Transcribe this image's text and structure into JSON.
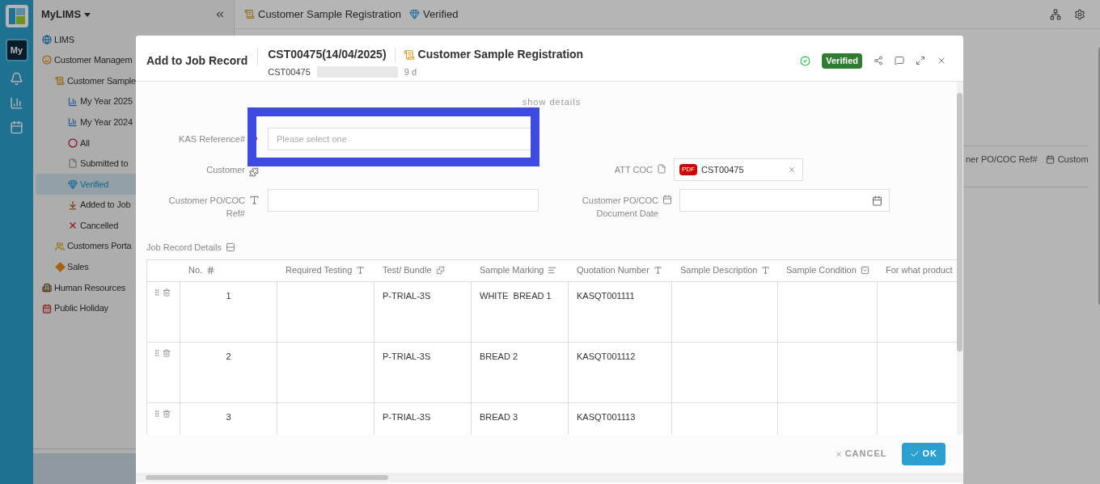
{
  "rail": {
    "badge": "My"
  },
  "sidebar": {
    "title": "MyLIMS",
    "items": [
      {
        "label": "LIMS",
        "selected": false
      },
      {
        "label": "Customer Managem",
        "selected": false,
        "children": [
          {
            "label": "Customer Sample",
            "selected": false,
            "children": [
              {
                "label": "My Year 2025",
                "selected": false
              },
              {
                "label": "My Year 2024",
                "selected": false
              },
              {
                "label": "All",
                "selected": false
              },
              {
                "label": "Submitted to",
                "selected": false
              },
              {
                "label": "Verified",
                "selected": true
              },
              {
                "label": "Added to Job",
                "selected": false
              },
              {
                "label": "Cancelled",
                "selected": false
              }
            ]
          },
          {
            "label": "Customers Porta",
            "selected": false
          },
          {
            "label": "Sales",
            "selected": false
          }
        ]
      },
      {
        "label": "Human Resources",
        "selected": false
      },
      {
        "label": "Public Holiday",
        "selected": false
      }
    ]
  },
  "top_bar": {
    "breadcrumbs": [
      "Customer Sample Registration",
      "Verified"
    ]
  },
  "background_table": {
    "columns": [
      "ner PO/COC Ref#",
      "Custom"
    ]
  },
  "dialog": {
    "title": "Add to Job Record",
    "record_title": "CST00475(14/04/2025)",
    "module": "Customer Sample Registration",
    "record_code": "CST00475",
    "age": "9 d",
    "status": "Verified",
    "show_details": "show details",
    "form_rows": [
      {
        "left": {
          "label": "KAS Reference#",
          "kind": "select",
          "placeholder": "Please select one",
          "required": true
        }
      },
      {
        "left": {
          "label": "Customer",
          "kind": "lookup",
          "required": false
        },
        "right": {
          "label": "ATT COC",
          "kind": "file",
          "file_type": "PDF",
          "value": "CST00475",
          "required": false
        }
      },
      {
        "left": {
          "label": "Customer PO/COC Ref#",
          "kind": "text",
          "required": false
        },
        "right": {
          "label": "Customer PO/COC Document Date",
          "kind": "date",
          "required": false
        }
      }
    ],
    "table_title": "Job Record Details",
    "columns": [
      {
        "label": "No.",
        "kind": "number"
      },
      {
        "label": "Required Testing",
        "kind": "text"
      },
      {
        "label": "Test/ Bundle",
        "kind": "lookup"
      },
      {
        "label": "Sample Marking",
        "kind": "textarea"
      },
      {
        "label": "Quotation Number",
        "kind": "text"
      },
      {
        "label": "Sample Description",
        "kind": "text"
      },
      {
        "label": "Sample Condition",
        "kind": "select"
      },
      {
        "label": "For what product",
        "kind": "plain"
      }
    ],
    "rows": [
      {
        "cells": [
          "1",
          null,
          "P-TRIAL-3S",
          "WHITE  BREAD 1",
          "KASQT001111",
          null,
          null,
          null
        ]
      },
      {
        "cells": [
          "2",
          null,
          "P-TRIAL-3S",
          "BREAD 2",
          "KASQT001112",
          null,
          null,
          null
        ]
      },
      {
        "cells": [
          "3",
          null,
          "P-TRIAL-3S",
          "BREAD 3",
          "KASQT001113",
          null,
          null,
          null
        ]
      }
    ],
    "buttons": [
      {
        "label": "CANCEL",
        "kind": "text"
      },
      {
        "label": "OK",
        "kind": "primary"
      }
    ]
  }
}
